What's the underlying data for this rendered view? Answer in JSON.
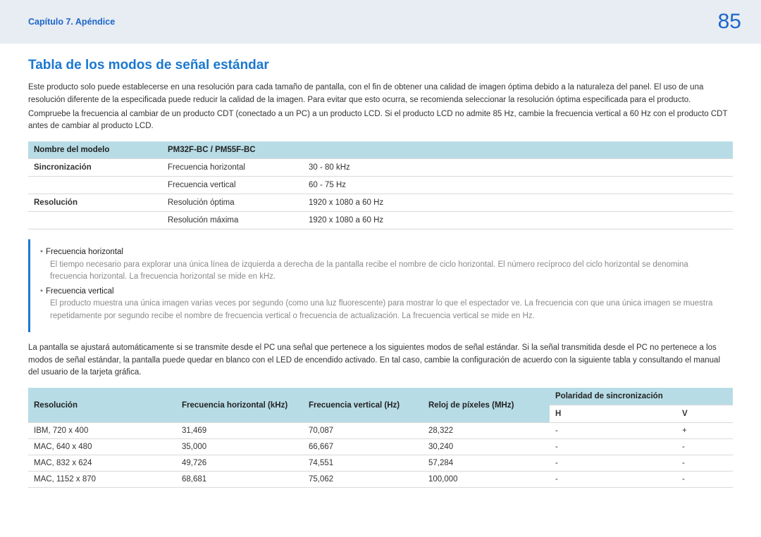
{
  "header": {
    "chapter": "Capítulo 7. Apéndice",
    "page": "85"
  },
  "title": "Tabla de los modos de señal estándar",
  "intro": {
    "p1": "Este producto solo puede establecerse en una resolución para cada tamaño de pantalla, con el fin de obtener una calidad de imagen óptima debido a la naturaleza del panel. El uso de una resolución diferente de la especificada puede reducir la calidad de la imagen. Para evitar que esto ocurra, se recomienda seleccionar la resolución óptima especificada para el producto.",
    "p2": "Compruebe la frecuencia al cambiar de un producto CDT (conectado a un PC) a un producto LCD. Si el producto LCD no admite 85 Hz, cambie la frecuencia vertical a 60 Hz con el producto CDT antes de cambiar al producto LCD."
  },
  "table1": {
    "h1": "Nombre del modelo",
    "h2": "PM32F-BC / PM55F-BC",
    "rows": [
      {
        "c1": "Sincronización",
        "c2": "Frecuencia horizontal",
        "c3": "30 - 80 kHz"
      },
      {
        "c1": "",
        "c2": "Frecuencia vertical",
        "c3": "60 - 75 Hz"
      },
      {
        "c1": "Resolución",
        "c2": "Resolución óptima",
        "c3": "1920 x 1080 a 60 Hz"
      },
      {
        "c1": "",
        "c2": "Resolución máxima",
        "c3": "1920 x 1080 a 60 Hz"
      }
    ]
  },
  "note": {
    "items": [
      {
        "title": "Frecuencia horizontal",
        "desc": "El tiempo necesario para explorar una única línea de izquierda a derecha de la pantalla recibe el nombre de ciclo horizontal. El número recíproco del ciclo horizontal se denomina frecuencia horizontal. La frecuencia horizontal se mide en kHz."
      },
      {
        "title": "Frecuencia vertical",
        "desc": "El producto muestra una única imagen varias veces por segundo (como una luz fluorescente) para mostrar lo que el espectador ve. La frecuencia con que una única imagen se muestra repetidamente por segundo recibe el nombre de frecuencia vertical o frecuencia de actualización. La frecuencia vertical se mide en Hz."
      }
    ]
  },
  "mid_para": "La pantalla se ajustará automáticamente si se transmite desde el PC una señal que pertenece a los siguientes modos de señal estándar. Si la señal transmitida desde el PC no pertenece a los modos de señal estándar, la pantalla puede quedar en blanco con el LED de encendido activado. En tal caso, cambie la configuración de acuerdo con la siguiente tabla y consultando el manual del usuario de la tarjeta gráfica.",
  "table2": {
    "headers": {
      "c1": "Resolución",
      "c2": "Frecuencia horizontal (kHz)",
      "c3": "Frecuencia vertical (Hz)",
      "c4": "Reloj de píxeles (MHz)",
      "c5": "Polaridad de sincronización",
      "c5h": "H",
      "c5v": "V"
    },
    "rows": [
      {
        "c1": "IBM, 720 x 400",
        "c2": "31,469",
        "c3": "70,087",
        "c4": "28,322",
        "h": "-",
        "v": "+"
      },
      {
        "c1": "MAC, 640 x 480",
        "c2": "35,000",
        "c3": "66,667",
        "c4": "30,240",
        "h": "-",
        "v": "-"
      },
      {
        "c1": "MAC, 832 x 624",
        "c2": "49,726",
        "c3": "74,551",
        "c4": "57,284",
        "h": "-",
        "v": "-"
      },
      {
        "c1": "MAC, 1152 x 870",
        "c2": "68,681",
        "c3": "75,062",
        "c4": "100,000",
        "h": "-",
        "v": "-"
      }
    ]
  }
}
